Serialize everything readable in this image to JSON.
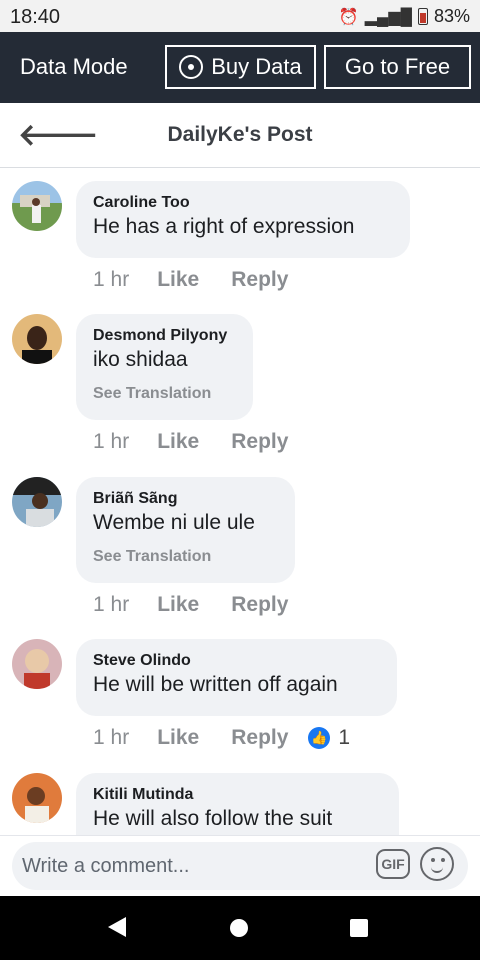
{
  "status": {
    "time": "18:40",
    "battery": "83%",
    "icons": [
      "alarm-icon",
      "signal-icon",
      "battery-icon"
    ]
  },
  "data_bar": {
    "mode_label": "Data Mode",
    "buy_label": "Buy Data",
    "free_label": "Go to Free"
  },
  "header": {
    "title": "DailyKe's Post",
    "back_icon": "back-arrow-icon"
  },
  "comments": [
    {
      "author": "Caroline Too",
      "text": "He has a right of expression",
      "translation": "",
      "time": "1 hr",
      "like": "Like",
      "reply": "Reply"
    },
    {
      "author": "Desmond Pilyony",
      "text": "iko shidaa",
      "translation": "See Translation",
      "time": "1 hr",
      "like": "Like",
      "reply": "Reply"
    },
    {
      "author": "Briãñ  Sãng",
      "text": "Wembe ni ule ule",
      "translation": "See Translation",
      "time": "1 hr",
      "like": "Like",
      "reply": "Reply"
    },
    {
      "author": "Steve Olindo",
      "text": "He will be written off again",
      "translation": "",
      "time": "1 hr",
      "like": "Like",
      "reply": "Reply",
      "reaction_count": "1"
    },
    {
      "author": "Kitili Mutinda",
      "text": "He will also follow the suit",
      "translation": "",
      "time": "",
      "like": "",
      "reply": ""
    }
  ],
  "composer": {
    "placeholder": "Write a comment...",
    "gif_label": "GIF"
  },
  "colors": {
    "data_bar_bg": "#242b36",
    "bubble_bg": "#f0f2f5",
    "like_blue": "#1877f2",
    "meta_gray": "#8a8d91"
  }
}
